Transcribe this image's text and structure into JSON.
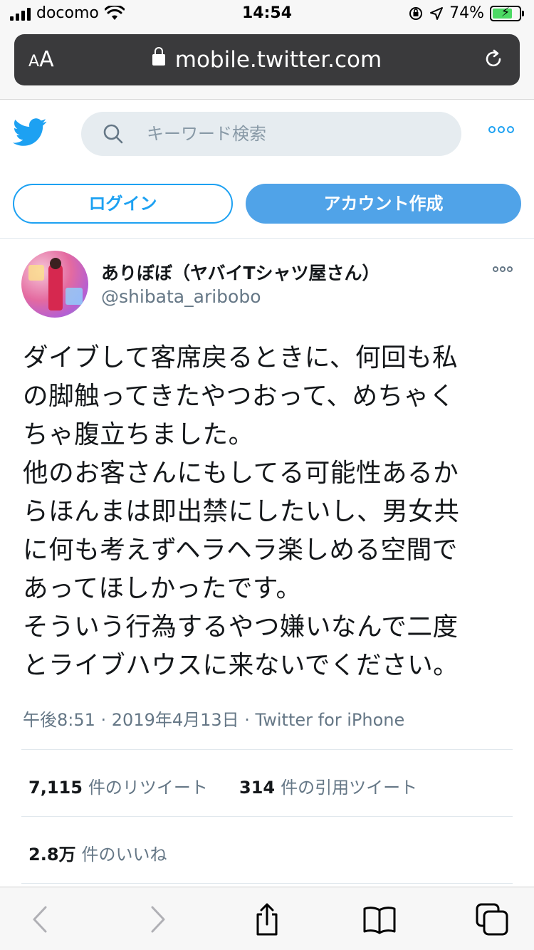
{
  "status_bar": {
    "carrier": "docomo",
    "time": "14:54",
    "battery_percent": "74%",
    "battery_level": 0.74
  },
  "browser": {
    "text_size_label_small": "A",
    "text_size_label_large": "A",
    "url": "mobile.twitter.com"
  },
  "twitter_header": {
    "search_placeholder": "キーワード検索",
    "login_label": "ログイン",
    "signup_label": "アカウント作成"
  },
  "tweet": {
    "display_name": "ありぼぼ（ヤバイTシャツ屋さん）",
    "handle": "@shibata_aribobo",
    "text_lines": [
      "ダイブして客席戻るときに、何回も私",
      "の脚触ってきたやつおって、めちゃく",
      "ちゃ腹立ちました。",
      "他のお客さんにもしてる可能性あるか",
      "らほんまは即出禁にしたいし、男女共",
      "に何も考えずヘラヘラ楽しめる空間で",
      "あってほしかったです。",
      "そういう行為するやつ嫌いなんで二度",
      "とライブハウスに来ないでください。"
    ],
    "meta": "午後8:51 · 2019年4月13日 · Twitter for iPhone",
    "retweets_count": "7,115",
    "retweets_label": "件のリツイート",
    "quotes_count": "314",
    "quotes_label": "件の引用ツイート",
    "likes_count": "2.8万",
    "likes_label": "件のいいね"
  },
  "colors": {
    "twitter_blue": "#1da1f2",
    "signup_blue": "#50a3e8",
    "secondary_text": "#657786",
    "address_bar": "#3a3a3c"
  }
}
